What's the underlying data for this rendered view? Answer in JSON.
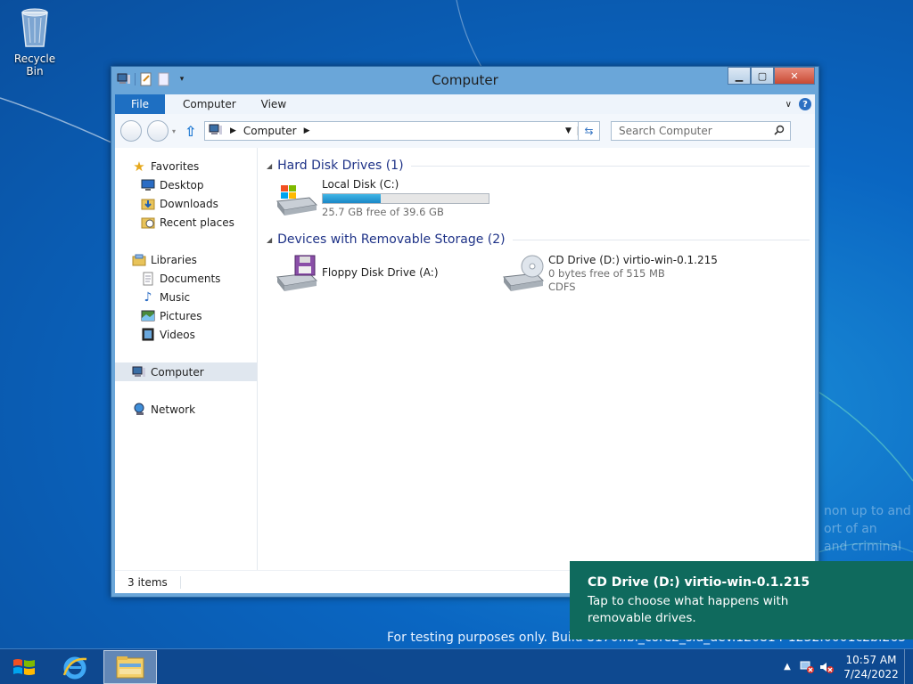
{
  "desktop": {
    "recycle_bin_label": "Recycle Bin",
    "watermark": "For testing purposes only. Build 8170.fbl_core2_sld_dev.120814-1232.0001c2b.2632.1x",
    "faint_text": [
      "non up to and",
      "ort of an",
      "and criminal"
    ]
  },
  "window": {
    "title": "Computer",
    "tabs": {
      "file": "File",
      "computer": "Computer",
      "view": "View"
    },
    "address": {
      "crumb": "Computer"
    },
    "search": {
      "placeholder": "Search Computer"
    },
    "nav": {
      "favorites": "Favorites",
      "desktop": "Desktop",
      "downloads": "Downloads",
      "recent": "Recent places",
      "libraries": "Libraries",
      "documents": "Documents",
      "music": "Music",
      "pictures": "Pictures",
      "videos": "Videos",
      "computer": "Computer",
      "network": "Network"
    },
    "groups": {
      "hdd": "Hard Disk Drives (1)",
      "removable": "Devices with Removable Storage (2)"
    },
    "drives": {
      "c": {
        "name": "Local Disk (C:)",
        "free": "25.7 GB free of 39.6 GB",
        "used_fraction": 0.35
      },
      "a": {
        "name": "Floppy Disk Drive (A:)"
      },
      "d": {
        "name": "CD Drive (D:) virtio-win-0.1.215",
        "free": "0 bytes free of 515 MB",
        "fs": "CDFS"
      }
    },
    "status": {
      "items": "3 items"
    }
  },
  "toast": {
    "title": "CD Drive (D:) virtio-win-0.1.215",
    "message": "Tap to choose what happens with removable drives."
  },
  "taskbar": {
    "time": "10:57 AM",
    "date": "7/24/2022"
  }
}
